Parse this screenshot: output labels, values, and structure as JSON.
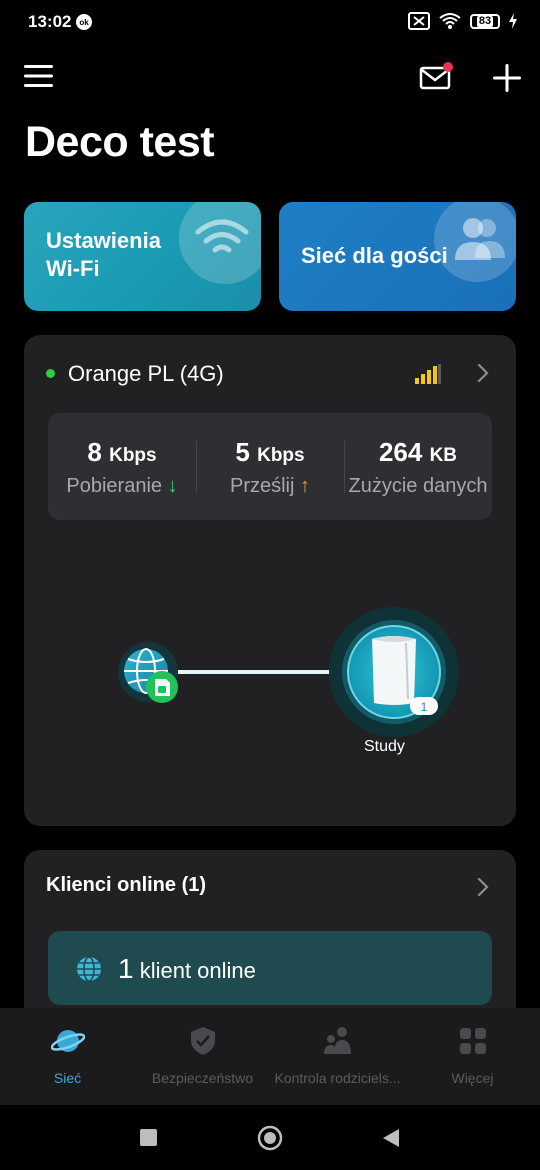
{
  "status_bar": {
    "time": "13:02",
    "battery": "83"
  },
  "header": {
    "title": "Deco test"
  },
  "tiles": [
    {
      "label_line1": "Ustawienia",
      "label_line2": "Wi-Fi",
      "icon": "wifi-icon"
    },
    {
      "label": "Sieć dla gości",
      "icon": "guests-icon"
    }
  ],
  "network": {
    "name": "Orange PL (4G)",
    "status_color": "#2ecc40",
    "signal_color": "#f5c518",
    "stats": [
      {
        "value": "8",
        "unit": "Kbps",
        "label": "Pobieranie",
        "arrow": "↓",
        "arrow_color": "#3ad07a"
      },
      {
        "value": "5",
        "unit": "Kbps",
        "label": "Prześlij",
        "arrow": "↑",
        "arrow_color": "#f59a23"
      },
      {
        "value": "264",
        "unit": "KB",
        "label": "Zużycie danych"
      }
    ],
    "node": {
      "name": "Study",
      "clients": "1"
    }
  },
  "clients": {
    "title": "Klienci online (1)",
    "count": "1",
    "text": "klient online"
  },
  "tabs": [
    {
      "label": "Sieć",
      "icon": "planet-icon",
      "active": true
    },
    {
      "label": "Bezpieczeństwo",
      "icon": "shield-icon",
      "active": false
    },
    {
      "label": "Kontrola rodziciels...",
      "icon": "family-icon",
      "active": false
    },
    {
      "label": "Więcej",
      "icon": "grid-icon",
      "active": false
    }
  ],
  "colors": {
    "accent": "#38a9d7",
    "unread_dot": "#e8334a"
  }
}
